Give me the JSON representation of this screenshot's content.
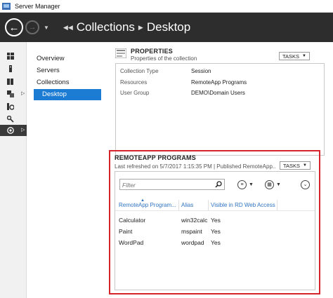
{
  "window": {
    "title": "Server Manager"
  },
  "nav": {
    "breadcrumb": [
      "Collections",
      "Desktop"
    ]
  },
  "icon_strip": [
    {
      "icon": "dashboard-icon"
    },
    {
      "icon": "local-server-icon"
    },
    {
      "icon": "all-servers-icon"
    },
    {
      "icon": "file-storage-icon"
    },
    {
      "icon": "iis-icon"
    },
    {
      "icon": "rds-keys-icon"
    },
    {
      "icon": "remote-desktop-services-icon"
    }
  ],
  "sidebar": {
    "items": [
      {
        "label": "Overview"
      },
      {
        "label": "Servers"
      },
      {
        "label": "Collections"
      },
      {
        "label": "Desktop"
      }
    ]
  },
  "properties": {
    "title": "PROPERTIES",
    "subtitle": "Properties of the collection",
    "tasks_label": "TASKS",
    "rows": [
      {
        "key": "Collection Type",
        "value": "Session"
      },
      {
        "key": "Resources",
        "value": "RemoteApp Programs"
      },
      {
        "key": "User Group",
        "value": "DEMO\\Domain Users"
      }
    ]
  },
  "remoteapp": {
    "title": "REMOTEAPP PROGRAMS",
    "subtitle": "Last refreshed on 5/7/2017 1:15:35 PM | Published RemoteApp...",
    "tasks_label": "TASKS",
    "filter_placeholder": "Filter",
    "columns": [
      "RemoteApp Program...",
      "Alias",
      "Visible in RD Web Access"
    ],
    "rows": [
      {
        "program": "Calculator",
        "alias": "win32calc",
        "visible": "Yes"
      },
      {
        "program": "Paint",
        "alias": "mspaint",
        "visible": "Yes"
      },
      {
        "program": "WordPad",
        "alias": "wordpad",
        "visible": "Yes"
      }
    ]
  },
  "colors": {
    "accent": "#1c7bd2",
    "highlight": "#d6242c",
    "navbar": "#2d2d2d",
    "link": "#2f74c0"
  }
}
